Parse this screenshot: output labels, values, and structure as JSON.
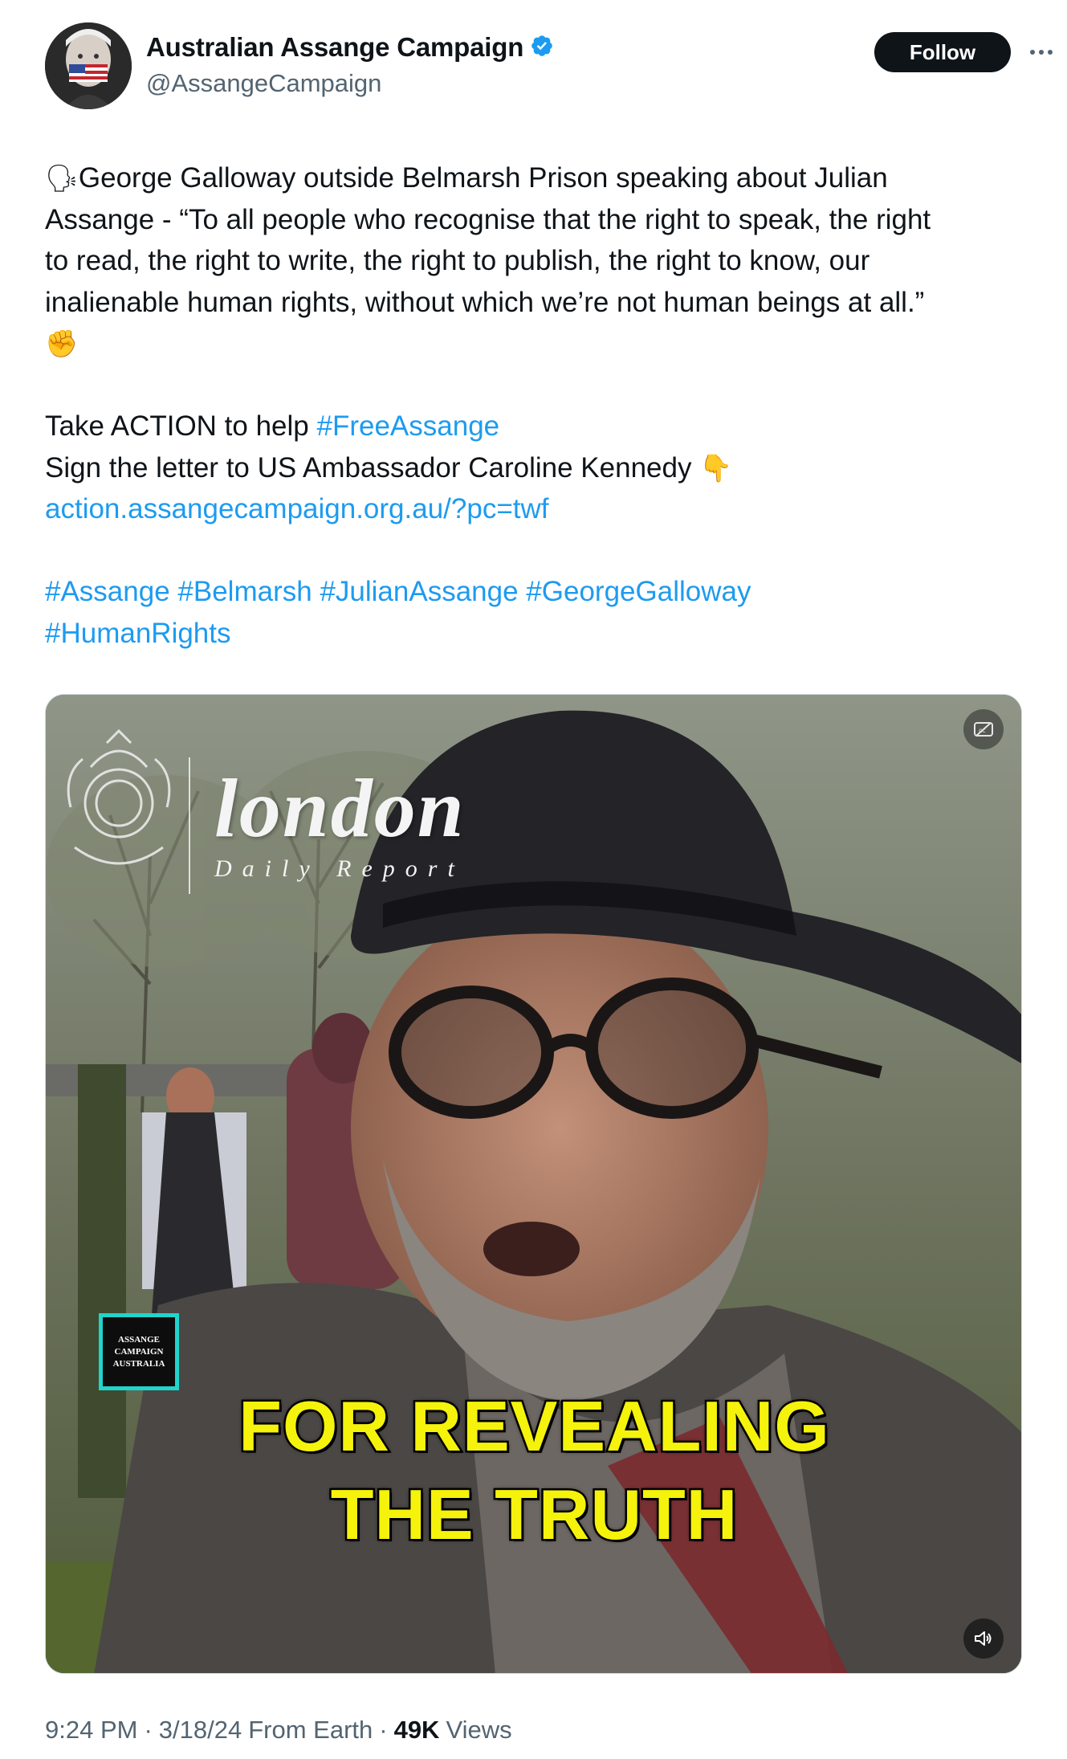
{
  "author": {
    "display_name": "Australian Assange Campaign",
    "handle": "@AssangeCampaign",
    "verified": true,
    "avatar_icon": "person-with-flag-gag-avatar"
  },
  "actions": {
    "follow_label": "Follow",
    "more_icon": "more-horizontal-icon"
  },
  "tweet": {
    "lead_emoji": "🗣",
    "line1": "George Galloway outside Belmarsh Prison speaking about Julian",
    "line2": "Assange - “To all people who recognise that the right to speak, the right",
    "line3": "to read, the right to write, the right to publish, the right to know, our",
    "line4": "inalienable human rights, without which we’re not human beings at all.”",
    "line5_emoji": "✊",
    "action_prefix": "Take ACTION to help ",
    "action_hashtag": "#FreeAssange",
    "sign_text": "Sign the letter to US Ambassador Caroline Kennedy ",
    "sign_emoji": "👇",
    "url": "action.assangecampaign.org.au/?pc=twf",
    "hashtags_line1": [
      "#Assange",
      "#Belmarsh",
      "#JulianAssange",
      "#GeorgeGalloway"
    ],
    "hashtags_line2": [
      "#HumanRights"
    ]
  },
  "media": {
    "logo_title": "london",
    "logo_subtitle": "Daily Report",
    "badge_lines": [
      "ASSANGE",
      "CAMPAIGN",
      "AUSTRALIA"
    ],
    "caption_line1": "FOR REVEALING",
    "caption_line2": "THE TRUTH",
    "cc_icon": "captions-off-icon",
    "volume_icon": "volume-muted-icon"
  },
  "meta": {
    "time": "9:24 PM",
    "date": "3/18/24",
    "source": "From Earth",
    "views_count": "49K",
    "views_label": "Views",
    "separator": "·"
  },
  "colors": {
    "link": "#1d9bf0",
    "text": "#0f1419",
    "secondary": "#536471",
    "caption_yellow": "#f5f20c",
    "badge_border": "#20d4cc"
  }
}
